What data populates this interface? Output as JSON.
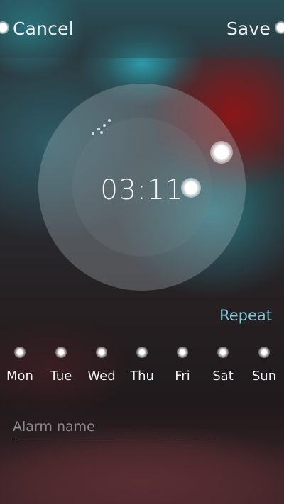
{
  "header": {
    "cancel_label": "Cancel",
    "save_label": "Save"
  },
  "time_picker": {
    "time": "03:11",
    "hour": 3,
    "minute": 11
  },
  "repeat": {
    "label": "Repeat",
    "days": [
      {
        "label": "Mon"
      },
      {
        "label": "Tue"
      },
      {
        "label": "Wed"
      },
      {
        "label": "Thu"
      },
      {
        "label": "Fri"
      },
      {
        "label": "Sat"
      },
      {
        "label": "Sun"
      }
    ]
  },
  "alarm_name": {
    "placeholder": "Alarm name",
    "value": ""
  },
  "colors": {
    "accent": "#7fc6d4",
    "text": "#eef2f4"
  }
}
